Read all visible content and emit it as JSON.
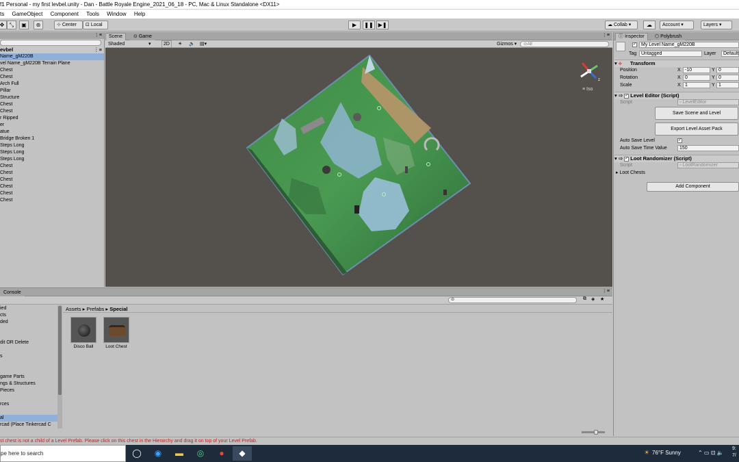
{
  "window": {
    "title": "f1 Personal - my first levbel.unity - Dan - Battle Royale Engine_2021_06_18 - PC, Mac & Linux Standalone <DX11>"
  },
  "menu": [
    "ts",
    "GameObject",
    "Component",
    "Tools",
    "Window",
    "Help"
  ],
  "toolbar": {
    "center_label": "Center",
    "local_label": "Local",
    "collab_label": "Collab",
    "account_label": "Account",
    "layers_label": "Layers"
  },
  "hierarchy": {
    "title": "evbel",
    "items": [
      {
        "label": "Name_gM220B",
        "selected": true
      },
      {
        "label": "vel Name_gM220B Terrain Plane",
        "selected": false
      },
      {
        "label": "Chest",
        "selected": false
      },
      {
        "label": "Chest",
        "selected": false
      },
      {
        "label": "Arch Full",
        "selected": false
      },
      {
        "label": "Pillar",
        "selected": false
      },
      {
        "label": "Structure",
        "selected": false
      },
      {
        "label": "Chest",
        "selected": false
      },
      {
        "label": "Chest",
        "selected": false
      },
      {
        "label": "r Ripped",
        "selected": false
      },
      {
        "label": "er",
        "selected": false
      },
      {
        "label": "atue",
        "selected": false
      },
      {
        "label": "Bridge Broken 1",
        "selected": false
      },
      {
        "label": "Steps Long",
        "selected": false
      },
      {
        "label": "Steps Long",
        "selected": false
      },
      {
        "label": "Steps Long",
        "selected": false
      },
      {
        "label": "Chest",
        "selected": false
      },
      {
        "label": "Chest",
        "selected": false
      },
      {
        "label": "Chest",
        "selected": false
      },
      {
        "label": "Chest",
        "selected": false
      },
      {
        "label": "Chest",
        "selected": false
      },
      {
        "label": "Chest",
        "selected": false
      }
    ]
  },
  "scene": {
    "tab_scene": "Scene",
    "tab_game": "Game",
    "shading": "Shaded",
    "mode_2d": "2D",
    "gizmos": "Gizmos",
    "search_placeholder": "All",
    "iso_label": "Iso"
  },
  "inspector": {
    "tab_inspector": "Inspector",
    "tab_polybrush": "Polybrush",
    "object_name": "My Level Name_gM220B",
    "tag_label": "Tag",
    "tag_value": "Untagged",
    "layer_label": "Layer",
    "layer_value": "Default",
    "transform": {
      "title": "Transform",
      "position_label": "Position",
      "rotation_label": "Rotation",
      "scale_label": "Scale",
      "position": {
        "x": "-10",
        "y": "0"
      },
      "rotation": {
        "x": "0",
        "y": "0"
      },
      "scale": {
        "x": "1",
        "y": "1"
      }
    },
    "level_editor": {
      "title": "Level Editor (Script)",
      "script_label": "Script",
      "script_value": "LevelEditor",
      "save_button": "Save Scene and Level",
      "export_button": "Export Level Asset Pack",
      "auto_save_label": "Auto Save Level",
      "auto_save_time_label": "Auto Save Time Value",
      "auto_save_time_value": "150"
    },
    "loot_randomizer": {
      "title": "Loot Randomizer (Script)",
      "script_label": "Script",
      "script_value": "LootRandomizer",
      "loot_chests_label": "Loot Chests"
    },
    "add_component": "Add Component"
  },
  "project": {
    "tab_console": "Console",
    "breadcrumb": [
      "Assets",
      "Prefabs",
      "Special"
    ],
    "folders": [
      {
        "label": "ied",
        "selected": false
      },
      {
        "label": "cts",
        "selected": false
      },
      {
        "label": "ded",
        "selected": false
      },
      {
        "label": "",
        "selected": false
      },
      {
        "label": "",
        "selected": false
      },
      {
        "label": "dit OR Delete",
        "selected": false
      },
      {
        "label": "",
        "selected": false
      },
      {
        "label": "s",
        "selected": false
      },
      {
        "label": "",
        "selected": false
      },
      {
        "label": "",
        "selected": false
      },
      {
        "label": "game Parts",
        "selected": false
      },
      {
        "label": "ngs & Structures",
        "selected": false
      },
      {
        "label": "Pieces",
        "selected": false
      },
      {
        "label": "",
        "selected": false
      },
      {
        "label": "rces",
        "selected": false
      },
      {
        "label": "",
        "selected": false
      },
      {
        "label": "al",
        "selected": true
      },
      {
        "label": "rcad (Place Tinkercad C",
        "selected": false
      }
    ],
    "assets": [
      {
        "label": "Disco Ball",
        "icon": "disco-ball-icon"
      },
      {
        "label": "Loot Chest",
        "icon": "loot-chest-icon"
      }
    ]
  },
  "status_bar": {
    "message": "st chest is not a child of a Level Prefab. Please click on this chest in the Hierarchy and drag it on top of your Level Prefab."
  },
  "taskbar": {
    "search_placeholder": "pe here to search",
    "weather": "76°F Sunny",
    "time": "9:",
    "date": "7/"
  }
}
